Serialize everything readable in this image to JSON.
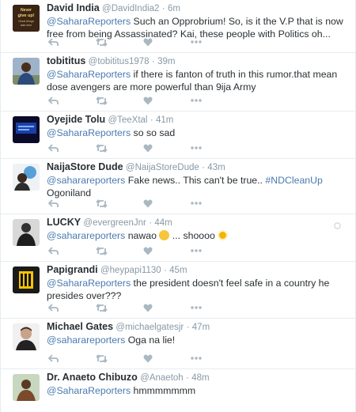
{
  "tweets": [
    {
      "fullname": "David India",
      "username": "@DavidIndia2",
      "time": "6m",
      "mention": "@SaharaReporters",
      "text": " Such an Opprobrium! So, is it the V.P that is now free from being Assassinated? Kai, these people with Politics oh...",
      "avatar_lines": [
        "Never",
        "give up!",
        "Great things",
        "take time"
      ]
    },
    {
      "fullname": "tobititus",
      "username": "@tobititus1978",
      "time": "39m",
      "mention": "@SaharaReporters",
      "text": " if there is fanton of truth in this rumor.that mean dose avengers are more powerful than 9ija Army"
    },
    {
      "fullname": "Oyejide Tolu",
      "username": "@TeeXtal",
      "time": "41m",
      "mention": "@SaharaReporters",
      "text": " so so sad"
    },
    {
      "fullname": "NaijaStore Dude",
      "username": "@NaijaStoreDude",
      "time": "43m",
      "mention": "@saharareporters",
      "text": " Fake news.. This can't be true.. ",
      "hashtag": "#NDCleanUp",
      "text_after": " Ogoniland"
    },
    {
      "fullname": "LUCKY",
      "username": "@evergreenJnr",
      "time": "44m",
      "mention": "@saharareporters",
      "text": " nawao ",
      "text_mid": " ... shoooo ",
      "emoji1": "smirk-emoji",
      "emoji2": "scream-emoji"
    },
    {
      "fullname": "Papigrandi",
      "username": "@heypapi1130",
      "time": "45m",
      "mention": "@SaharaReporters",
      "text": " the president doesn't feel safe in a country he presides over???"
    },
    {
      "fullname": "Michael Gates",
      "username": "@michaelgatesjr",
      "time": "47m",
      "mention": "@saharareporters",
      "text": " Oga na lie!"
    },
    {
      "fullname": "Dr. Anaeto Chibuzo",
      "username": "@Anaetoh",
      "time": "48m",
      "mention": "@SaharaReporters",
      "text": " hmmmmmmm"
    }
  ],
  "separator": "·",
  "colors": {
    "mention": "#4a7ab0",
    "meta": "#8899a6",
    "icon": "#aab8c2",
    "border": "#e6ecf0"
  },
  "icons": [
    "reply-icon",
    "retweet-icon",
    "like-icon",
    "more-icon"
  ]
}
